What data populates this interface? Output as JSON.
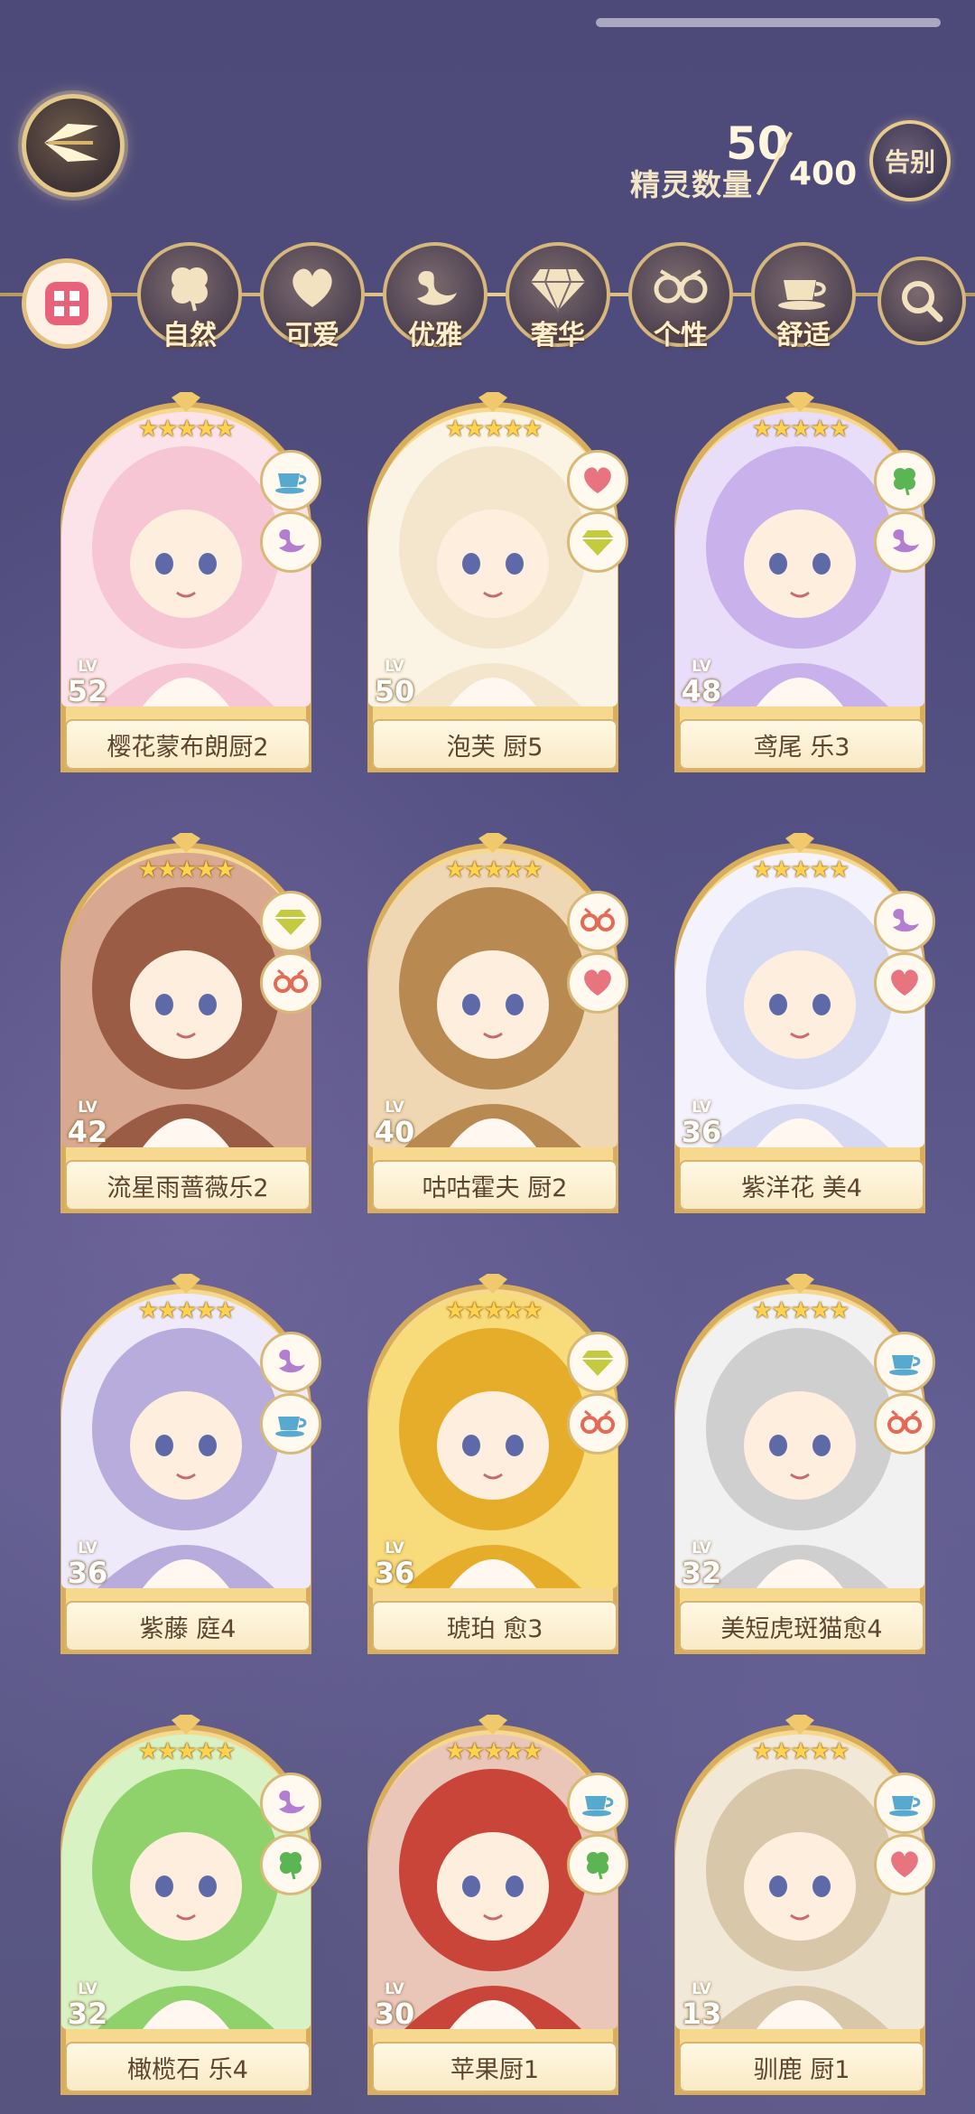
{
  "header": {
    "count_label": "精灵数量",
    "count_current": "50",
    "count_total": "400",
    "goodbye_label": "告别"
  },
  "filters": [
    {
      "label": "自然",
      "icon": "clover-icon"
    },
    {
      "label": "可爱",
      "icon": "heart-icon"
    },
    {
      "label": "优雅",
      "icon": "swan-icon"
    },
    {
      "label": "奢华",
      "icon": "diamond-icon"
    },
    {
      "label": "个性",
      "icon": "glasses-icon"
    },
    {
      "label": "舒适",
      "icon": "teacup-icon"
    }
  ],
  "colors": {
    "accent_gold": "#e4c98a",
    "heart": "#e8747f",
    "clover": "#5bb552",
    "swan": "#b47ed0",
    "diamond": "#c5cb3e",
    "glasses": "#e46a56",
    "teacup": "#58a9cf"
  },
  "cards": [
    {
      "name": "樱花蒙布朗厨2",
      "level": "52",
      "stars": "★★★★★",
      "badges": [
        "teacup",
        "swan"
      ],
      "palette": [
        "#f7c6d4",
        "#fce3ea"
      ]
    },
    {
      "name": "泡芙 厨5",
      "level": "50",
      "stars": "★★★★★",
      "badges": [
        "heart",
        "diamond"
      ],
      "palette": [
        "#f3e6cc",
        "#fbf4e4"
      ]
    },
    {
      "name": "鸢尾 乐3",
      "level": "48",
      "stars": "★★★★★",
      "badges": [
        "clover",
        "swan"
      ],
      "palette": [
        "#c9b2ec",
        "#e9defa"
      ]
    },
    {
      "name": "流星雨蔷薇乐2",
      "level": "42",
      "stars": "★★★★★",
      "badges": [
        "diamond",
        "glasses"
      ],
      "palette": [
        "#9a5c44",
        "#d9a890"
      ]
    },
    {
      "name": "咕咕霍夫 厨2",
      "level": "40",
      "stars": "★★★★★",
      "badges": [
        "glasses",
        "heart"
      ],
      "palette": [
        "#b88a52",
        "#efd7b3"
      ]
    },
    {
      "name": "紫洋花 美4",
      "level": "36",
      "stars": "★★★★★",
      "badges": [
        "swan",
        "heart"
      ],
      "palette": [
        "#d7d9f3",
        "#f3f2fd"
      ]
    },
    {
      "name": "紫藤 庭4",
      "level": "36",
      "stars": "★★★★★",
      "badges": [
        "swan",
        "teacup"
      ],
      "palette": [
        "#b7acdc",
        "#eeeaf9"
      ]
    },
    {
      "name": "琥珀 愈3",
      "level": "36",
      "stars": "★★★★★",
      "badges": [
        "diamond",
        "glasses"
      ],
      "palette": [
        "#e6ad2a",
        "#f8db7b"
      ]
    },
    {
      "name": "美短虎斑猫愈4",
      "level": "32",
      "stars": "★★★★★",
      "badges": [
        "teacup",
        "glasses"
      ],
      "palette": [
        "#cfcfcf",
        "#f1f1f1"
      ]
    },
    {
      "name": "橄榄石 乐4",
      "level": "32",
      "stars": "★★★★★",
      "badges": [
        "swan",
        "clover"
      ],
      "palette": [
        "#8fd26c",
        "#d8f2c4"
      ]
    },
    {
      "name": "苹果厨1",
      "level": "30",
      "stars": "★★★★★",
      "badges": [
        "teacup",
        "clover"
      ],
      "palette": [
        "#c9453a",
        "#e9c6b8"
      ]
    },
    {
      "name": "驯鹿 厨1",
      "level": "13",
      "stars": "★★★★★",
      "badges": [
        "teacup",
        "heart"
      ],
      "palette": [
        "#d9c7aa",
        "#f2e8d8"
      ]
    }
  ],
  "lv_tag": "LV"
}
